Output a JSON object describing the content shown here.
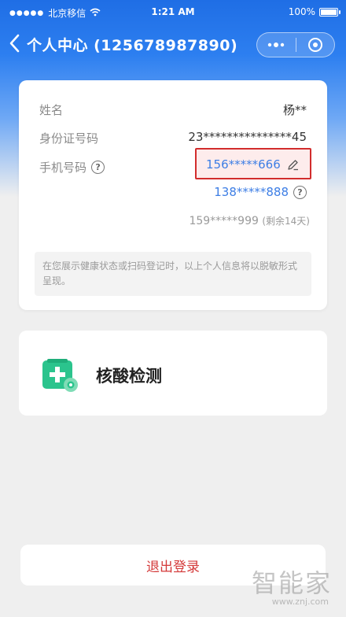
{
  "status_bar": {
    "signal_dots": "●●●●●",
    "carrier": "北京移信",
    "wifi_icon": "wifi-icon",
    "time": "1:21 AM",
    "battery_text": "100%",
    "battery_level": 1.0
  },
  "nav": {
    "back_icon": "chevron-left-icon",
    "title": "个人中心 (125678987890)",
    "more_icon": "more-dots-icon",
    "close_icon": "record-ring-icon"
  },
  "profile": {
    "name_label": "姓名",
    "name_value": "杨**",
    "id_label": "身份证号码",
    "id_value": "23***************45",
    "phone_label": "手机号码",
    "phone_help_glyph": "?",
    "phone_primary": "156*****666",
    "phone_secondary": "138*****888",
    "phone_tertiary": "159*****999",
    "phone_tertiary_note": "(剩余14天)",
    "notice": "在您展示健康状态或扫码登记时，以上个人信息将以脱敏形式呈现。"
  },
  "nucleic": {
    "label": "核酸检测",
    "icon": "nucleic-test-icon",
    "accent": "#27c48a"
  },
  "logout": {
    "label": "退出登录",
    "color": "#d43a3a"
  },
  "watermark": {
    "text": "智能家",
    "url": "www.znj.com"
  },
  "colors": {
    "header_blue": "#1f6ee5",
    "link_blue": "#3d7ee5",
    "highlight_red": "#d22d2d"
  }
}
